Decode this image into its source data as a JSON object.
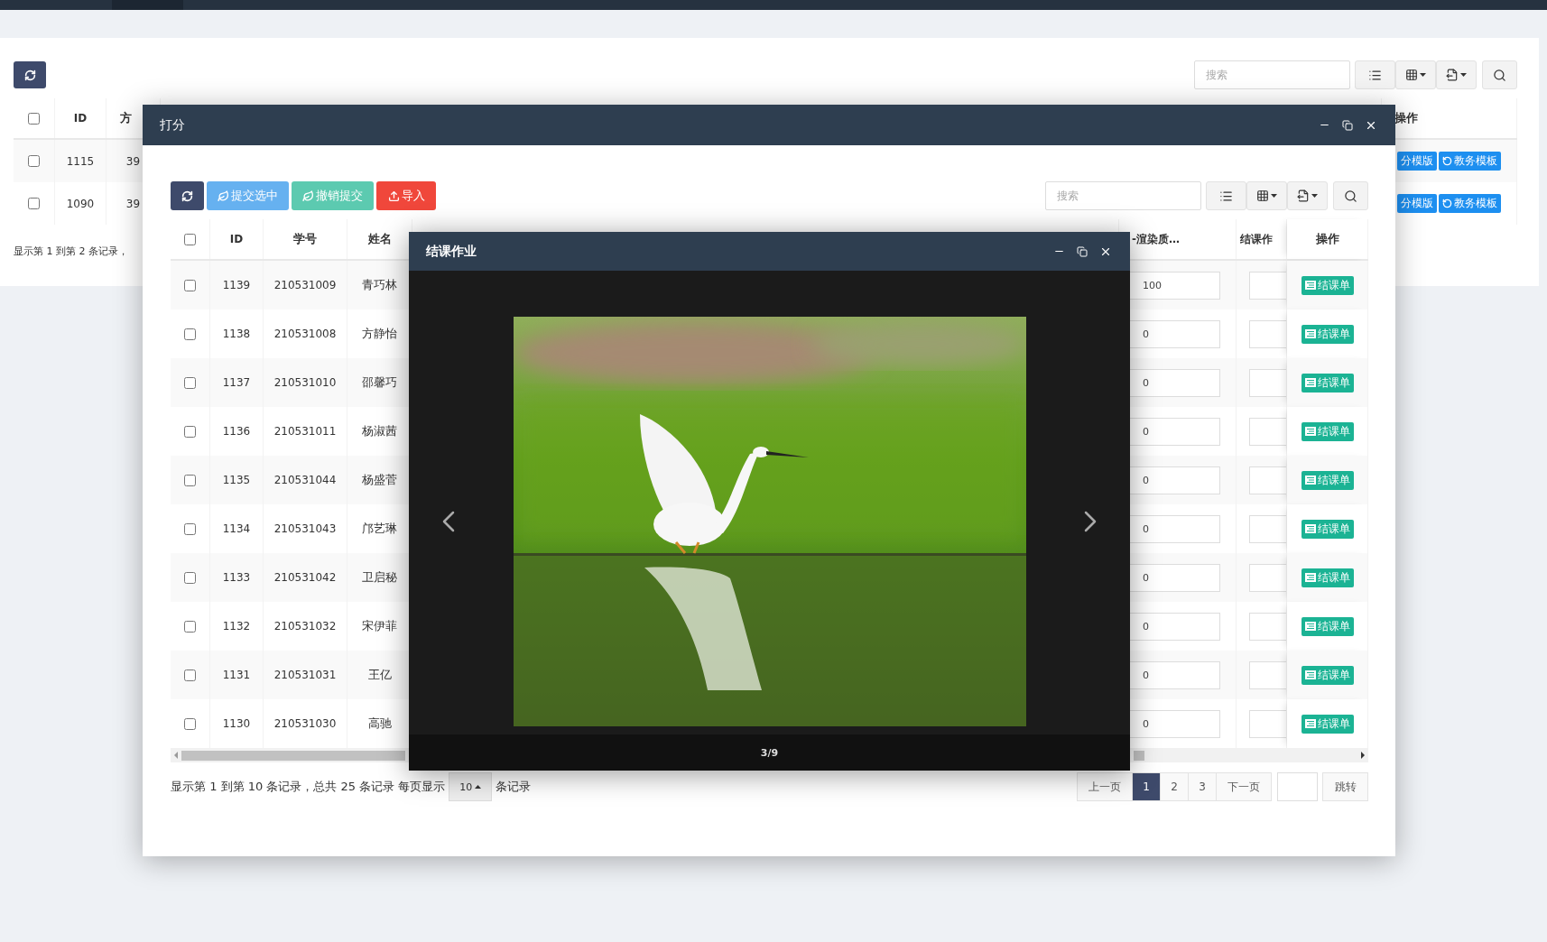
{
  "main_table": {
    "search": {
      "placeholder": "搜索"
    },
    "select_all": {
      "checked": false
    },
    "columns": [
      "ID",
      "方"
    ],
    "action_column": "操作",
    "rows": [
      {
        "checked": false,
        "id": "1115",
        "column_3": "39",
        "actions": [
          {
            "kind": "score",
            "label": "分模版"
          },
          {
            "kind": "academic",
            "label": "教务模板"
          }
        ]
      },
      {
        "checked": false,
        "id": "1090",
        "column_3": "39",
        "actions": [
          {
            "kind": "score",
            "label": "分模版"
          },
          {
            "kind": "academic",
            "label": "教务模板"
          }
        ]
      }
    ],
    "footer": "显示第 1 到第 2 条记录，"
  },
  "score_dialog": {
    "title": "打分",
    "toolbar": [
      {
        "kind": "refresh"
      },
      {
        "kind": "submit",
        "label": "提交选中"
      },
      {
        "kind": "revoke",
        "label": "撤销提交"
      },
      {
        "kind": "import",
        "label": "导入"
      }
    ],
    "search": {
      "placeholder": "搜索"
    },
    "select_all": {
      "checked": false
    },
    "columns": {
      "id": "ID",
      "student_no": "学号",
      "name": "姓名",
      "score": "-渲染质…",
      "homework": "结课作",
      "action": "操作"
    },
    "rows": [
      {
        "checked": false,
        "id": "1139",
        "student_no": "210531009",
        "name": "青巧林",
        "score": "100",
        "action": "结课单"
      },
      {
        "checked": false,
        "id": "1138",
        "student_no": "210531008",
        "name": "方静怡",
        "score": "0",
        "action": "结课单"
      },
      {
        "checked": false,
        "id": "1137",
        "student_no": "210531010",
        "name": "邵馨巧",
        "score": "0",
        "action": "结课单"
      },
      {
        "checked": false,
        "id": "1136",
        "student_no": "210531011",
        "name": "杨淑茜",
        "score": "0",
        "action": "结课单"
      },
      {
        "checked": false,
        "id": "1135",
        "student_no": "210531044",
        "name": "杨盛菅",
        "score": "0",
        "action": "结课单"
      },
      {
        "checked": false,
        "id": "1134",
        "student_no": "210531043",
        "name": "邝艺琳",
        "score": "0",
        "action": "结课单"
      },
      {
        "checked": false,
        "id": "1133",
        "student_no": "210531042",
        "name": "卫启秘",
        "score": "0",
        "action": "结课单"
      },
      {
        "checked": false,
        "id": "1132",
        "student_no": "210531032",
        "name": "宋伊菲",
        "score": "0",
        "action": "结课单"
      },
      {
        "checked": false,
        "id": "1131",
        "student_no": "210531031",
        "name": "王亿",
        "score": "0",
        "action": "结课单"
      },
      {
        "checked": false,
        "id": "1130",
        "student_no": "210531030",
        "name": "高驰",
        "score": "0",
        "action": "结课单"
      }
    ],
    "footer": {
      "summary": "显示第 1 到第 10 条记录，总共 25 条记录 每页显示",
      "page_size": "10",
      "suffix": "条记录"
    },
    "pagination": {
      "prev": "上一页",
      "pages": [
        {
          "label": "1",
          "selected": true
        },
        {
          "label": "2",
          "selected": false
        },
        {
          "label": "3",
          "selected": false
        }
      ],
      "next": "下一页",
      "go": "跳转"
    }
  },
  "viewer": {
    "title": "结课作业",
    "counter": "3/9"
  }
}
